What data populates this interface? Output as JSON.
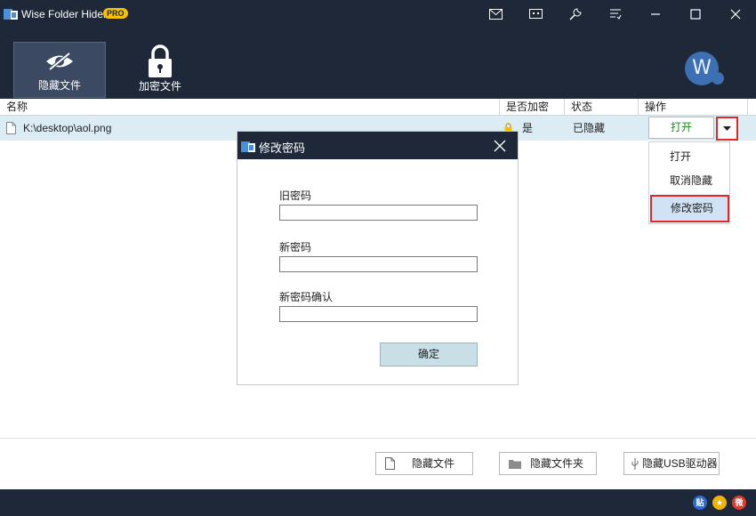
{
  "app": {
    "title": "Wise Folder Hider",
    "badge": "PRO"
  },
  "toolbar": {
    "tabs": [
      {
        "label": "隐藏文件",
        "icon": "eye-hidden-icon",
        "active": true
      },
      {
        "label": "加密文件",
        "icon": "lock-icon",
        "active": false
      }
    ],
    "avatar_letter": "W"
  },
  "table": {
    "columns": [
      "名称",
      "是否加密",
      "状态",
      "操作"
    ],
    "rows": [
      {
        "name": "K:\\desktop\\aol.png",
        "encrypted": "是",
        "status": "已隐藏",
        "action": "打开"
      }
    ]
  },
  "dropdown_menu": {
    "items": [
      "打开",
      "取消隐藏",
      "修改密码"
    ],
    "highlighted": "修改密码"
  },
  "dialog": {
    "title": "修改密码",
    "fields": [
      {
        "label": "旧密码",
        "value": ""
      },
      {
        "label": "新密码",
        "value": ""
      },
      {
        "label": "新密码确认",
        "value": ""
      }
    ],
    "ok_label": "确定"
  },
  "bottom_buttons": [
    {
      "label": "隐藏文件",
      "icon": "file-icon"
    },
    {
      "label": "隐藏文件夹",
      "icon": "folder-icon"
    },
    {
      "label": "隐藏USB驱动器",
      "icon": "usb-icon"
    }
  ],
  "status_icons": [
    {
      "icon": "tieba-icon",
      "text": "贴"
    },
    {
      "icon": "star-icon",
      "text": "★"
    },
    {
      "icon": "weibo-icon",
      "text": "微"
    }
  ],
  "colors": {
    "dark_navy": "#1e2838",
    "row_highlight": "#dcecf5",
    "annotation_red": "#e52626",
    "open_green": "#1c8a1c",
    "ok_button": "#c8dfe7"
  }
}
